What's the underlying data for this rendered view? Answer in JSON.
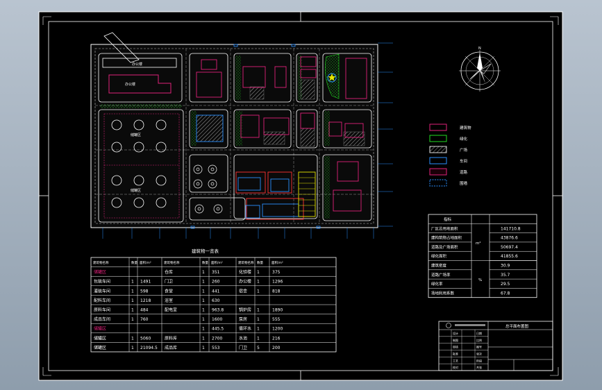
{
  "sheet": {
    "title_block_caption": "总平面布置图"
  },
  "site_labels": {
    "office": "办公楼",
    "tank_area_1": "储罐区",
    "tank_area_2": "储罐区",
    "parking_left": "停车场",
    "grid_marks": [
      "A",
      "B",
      "C",
      "D",
      "E",
      "F",
      "G",
      "H",
      "I"
    ]
  },
  "compass": {
    "label": "N"
  },
  "legend": {
    "items": [
      {
        "label": "建筑物",
        "color": "#e0227a",
        "pattern": "solid"
      },
      {
        "label": "绿化",
        "color": "#22dd22",
        "pattern": "solid"
      },
      {
        "label": "广场",
        "color": "#dddddd",
        "pattern": "hatch"
      },
      {
        "label": "车间",
        "color": "#2a8fff",
        "pattern": "solid"
      },
      {
        "label": "道路",
        "color": "#e0227a",
        "pattern": "dark"
      },
      {
        "label": "围墙",
        "color": "#2a8fff",
        "pattern": "dash"
      }
    ]
  },
  "stats": {
    "unit_area": "m²",
    "unit_pct": "%",
    "header": "指标",
    "rows": [
      {
        "label": "厂区总用地面积",
        "value": "141710.8"
      },
      {
        "label": "建构筑物占地面积",
        "value": "43876.6"
      },
      {
        "label": "道路及广场面积",
        "value": "50697.4"
      },
      {
        "label": "绿化面积",
        "value": "41855.6"
      },
      {
        "label": "建筑密度",
        "value": "30.9"
      },
      {
        "label": "道路广场率",
        "value": "35.7"
      },
      {
        "label": "绿化率",
        "value": "29.5"
      },
      {
        "label": "场地利用系数",
        "value": "67.8"
      }
    ]
  },
  "building_table": {
    "title": "建筑物一览表",
    "headers": [
      "建筑物名称",
      "数量",
      "面积/m²",
      "建筑物名称",
      "数量",
      "面积/m²",
      "建筑物名称",
      "数量",
      "面积/m²"
    ],
    "rows": [
      [
        "储罐区",
        "",
        "",
        "仓库",
        "1",
        "351",
        "化验楼",
        "1",
        "375"
      ],
      [
        "包装车间",
        "1",
        "1491",
        "门卫",
        "1",
        "260",
        "办公楼",
        "1",
        "1296"
      ],
      [
        "灌装车间",
        "1",
        "598",
        "食堂",
        "1",
        "441",
        "宿舍",
        "1",
        "818"
      ],
      [
        "配料车间",
        "1",
        "1218",
        "浴室",
        "1",
        "630",
        "",
        "",
        ""
      ],
      [
        "原料车间",
        "1",
        "484",
        "配电室",
        "1",
        "963.8",
        "锅炉房",
        "1",
        "1890"
      ],
      [
        "成品车间",
        "1",
        "760",
        "",
        "1",
        "1600",
        "泵房",
        "1",
        "555"
      ],
      [
        "储罐区",
        "",
        "",
        "",
        "1",
        "445.5",
        "循环水",
        "1",
        "1200"
      ],
      [
        "储罐区",
        "1",
        "5060",
        "原料库",
        "1",
        "2700",
        "水池",
        "1",
        "216"
      ],
      [
        "储罐区",
        "1",
        "21094.5",
        "成品库",
        "1",
        "553",
        "门卫",
        "5",
        "200"
      ]
    ]
  },
  "title_block": {
    "rows": [
      [
        "设计",
        "",
        "日期",
        ""
      ],
      [
        "制图",
        "",
        "比例",
        ""
      ],
      [
        "审核",
        "",
        "图号",
        ""
      ],
      [
        "批准",
        "",
        "张次",
        ""
      ],
      [
        "工艺",
        "",
        "阶段",
        ""
      ],
      [
        "校对",
        "",
        "共张",
        ""
      ]
    ]
  },
  "colors": {
    "frame": "#ffffff",
    "magenta": "#e0227a",
    "green": "#22dd22",
    "blue": "#2a8fff",
    "yellow": "#e6e600",
    "red": "#ff3333"
  }
}
